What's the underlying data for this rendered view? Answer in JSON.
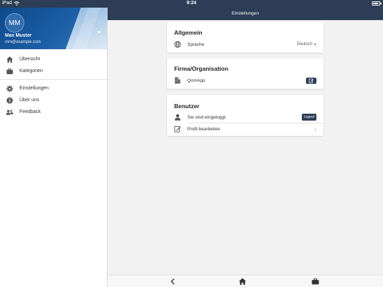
{
  "status_bar": {
    "carrier": "iPad",
    "time": "9:24",
    "battery_level": 0.85
  },
  "navbar": {
    "title": "Einstellungen"
  },
  "sidebar": {
    "profile": {
      "initials": "MM",
      "name": "Max Muster",
      "email": "mm@example.com"
    },
    "group1": [
      {
        "label": "Übersicht",
        "icon": "home-icon"
      },
      {
        "label": "Kategorien",
        "icon": "briefcase-icon"
      }
    ],
    "group2": [
      {
        "label": "Einstellungen",
        "icon": "gear-icon"
      },
      {
        "label": "Über uns",
        "icon": "info-icon"
      },
      {
        "label": "Feedback",
        "icon": "people-icon"
      }
    ]
  },
  "sections": {
    "general": {
      "title": "Allgemein",
      "language_label": "Sprache",
      "language_value": "Deutsch"
    },
    "company": {
      "title": "Firma/Organisation",
      "company_name": "QomApp"
    },
    "user": {
      "title": "Benutzer",
      "logged_in_text": "Sie sind eingeloggt.",
      "logout_label": "Logout",
      "edit_profile_label": "Profil bearbeiten"
    }
  },
  "colors": {
    "primary": "#2c3d55",
    "profile_blue": "#1b5fa6",
    "background": "#f2f2f2"
  }
}
